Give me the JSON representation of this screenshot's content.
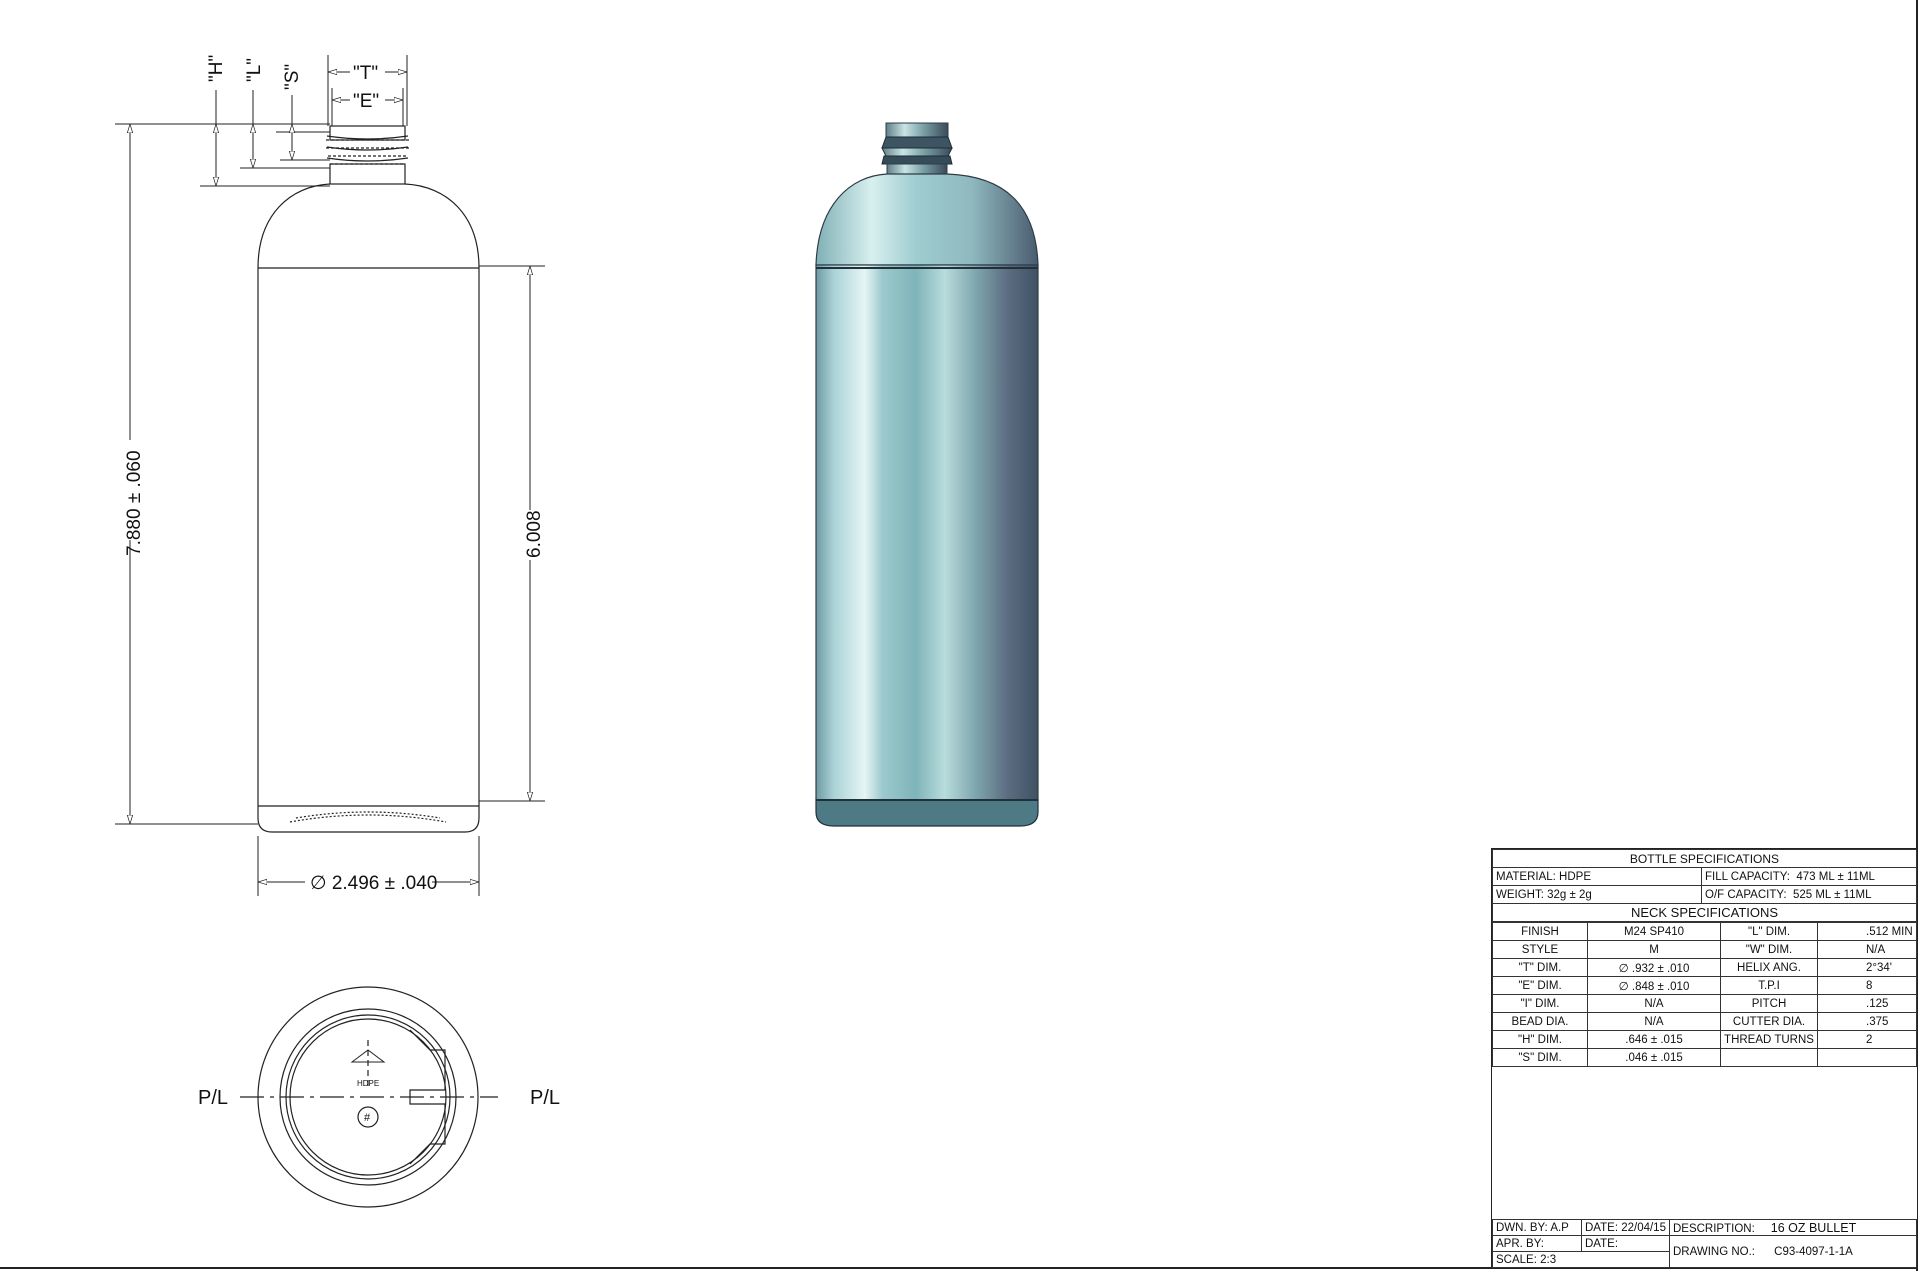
{
  "drawing": {
    "dims": {
      "h_label": "\"H\"",
      "l_label": "\"L\"",
      "s_label": "\"S\"",
      "t_label": "\"T\"",
      "e_label": "\"E\"",
      "overall_height": "7.880 ± .060",
      "body_height": "6.008",
      "diameter": "∅ 2.496 ± .040"
    },
    "bottom_view": {
      "pl_left": "P/L",
      "pl_right": "P/L",
      "resin_code": "HDPE",
      "cavity_mark": "#"
    }
  },
  "bottle_specs": {
    "title": "BOTTLE SPECIFICATIONS",
    "material": "MATERIAL:  HDPE",
    "fill_capacity_label": "FILL CAPACITY:",
    "fill_capacity_value": "473 ML ± 11ML",
    "weight": "WEIGHT:  32g ± 2g",
    "of_capacity_label": "O/F CAPACITY:",
    "of_capacity_value": "525 ML ± 11ML"
  },
  "neck_specs": {
    "title": "NECK SPECIFICATIONS",
    "rows": [
      [
        "FINISH",
        "M24 SP410",
        "\"L\" DIM.",
        ".512 MIN"
      ],
      [
        "STYLE",
        "M",
        "\"W\" DIM.",
        "N/A"
      ],
      [
        "\"T\" DIM.",
        "∅ .932 ± .010",
        "HELIX ANG.",
        "2°34'"
      ],
      [
        "\"E\" DIM.",
        "∅ .848 ± .010",
        "T.P.I",
        "8"
      ],
      [
        "\"I\" DIM.",
        "N/A",
        "PITCH",
        ".125"
      ],
      [
        "BEAD DIA.",
        "N/A",
        "CUTTER DIA.",
        ".375"
      ],
      [
        "\"H\" DIM.",
        ".646 ± .015",
        "THREAD TURNS",
        "2"
      ],
      [
        "\"S\" DIM.",
        ".046 ± .015",
        "",
        ""
      ]
    ]
  },
  "title_block": {
    "drawn_by": "DWN. BY: A.P",
    "date1": "DATE: 22/04/15",
    "description_label": "DESCRIPTION:",
    "description_value": "16 OZ BULLET",
    "approved_by": "APR. BY:",
    "date2": "DATE:",
    "drawing_no_label": "DRAWING NO.:",
    "drawing_no_value": "C93-4097-1-1A",
    "scale": "SCALE:  2:3"
  },
  "colors": {
    "bottle_light": "#cfe7ea",
    "bottle_mid": "#8fc2c6",
    "bottle_dark": "#4f6f7c",
    "line": "#222222"
  }
}
